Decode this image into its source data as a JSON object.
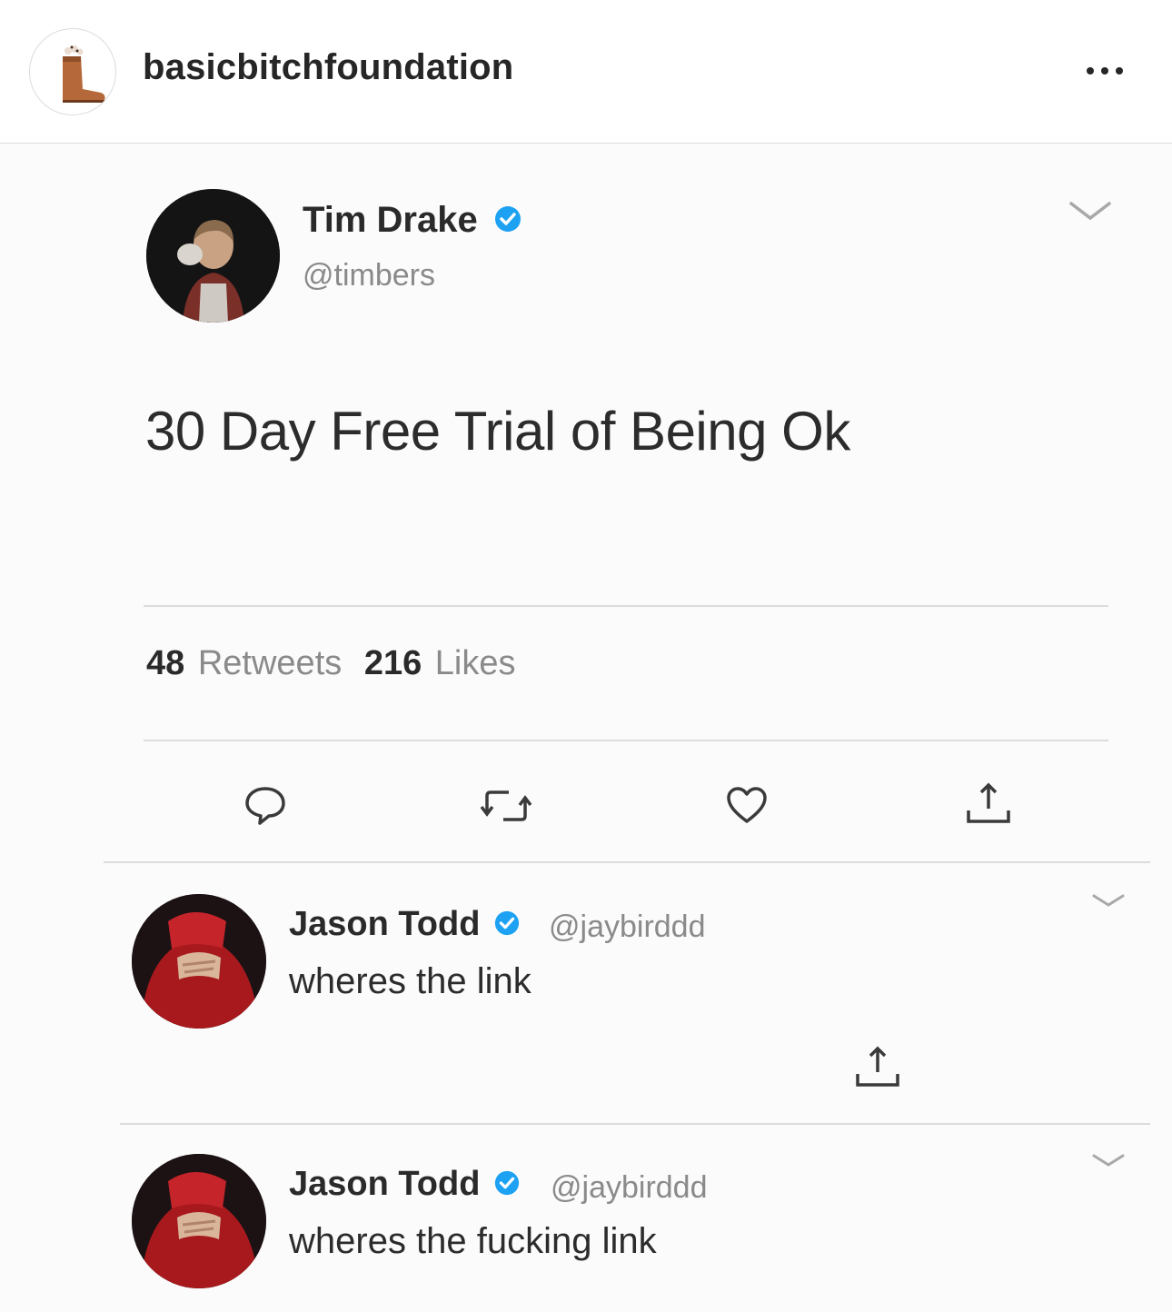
{
  "instagram": {
    "username": "basicbitchfoundation",
    "avatar_icon": "boot-icon",
    "more_icon": "more-options-icon"
  },
  "tweet": {
    "author_name": "Tim Drake",
    "author_handle": "@timbers",
    "verified_icon": "verified-badge-icon",
    "text": "30 Day Free Trial of Being Ok",
    "retweets_count": "48",
    "retweets_label": "Retweets",
    "likes_count": "216",
    "likes_label": "Likes",
    "actions": [
      "reply-icon",
      "retweet-icon",
      "like-icon",
      "share-icon"
    ]
  },
  "replies": [
    {
      "author_name": "Jason Todd",
      "author_handle": "@jaybirddd",
      "text": "wheres the link"
    },
    {
      "author_name": "Jason Todd",
      "author_handle": "@jaybirddd",
      "text": "wheres the fucking link"
    }
  ],
  "colors": {
    "verified_blue": "#1da1f2",
    "divider": "#dcdcdc",
    "muted_text": "#8a8a8a"
  }
}
